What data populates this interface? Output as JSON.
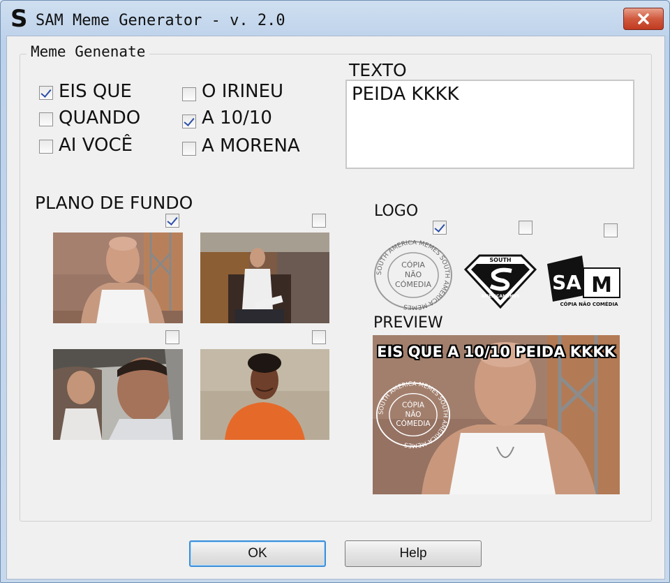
{
  "window": {
    "icon_letter": "S",
    "title": "SAM Meme Generator - v. 2.0"
  },
  "group": {
    "label": "Meme Genenate"
  },
  "intro_options": [
    {
      "label": "EIS QUE",
      "checked": true
    },
    {
      "label": "QUANDO",
      "checked": false
    },
    {
      "label": "AI VOCÊ",
      "checked": false
    },
    {
      "label": "O IRINEU",
      "checked": false
    },
    {
      "label": "A 10/10",
      "checked": true
    },
    {
      "label": "A MORENA",
      "checked": false
    }
  ],
  "texto": {
    "heading": "TEXTO",
    "value": "PEIDA KKKK"
  },
  "background": {
    "heading": "PLANO DE FUNDO",
    "options": [
      {
        "name": "bald-man-tank-top",
        "checked": true
      },
      {
        "name": "man-seated-chair",
        "checked": false
      },
      {
        "name": "man-in-car",
        "checked": false
      },
      {
        "name": "man-orange-shirt",
        "checked": false
      }
    ]
  },
  "logo": {
    "heading": "LOGO",
    "options": [
      {
        "name": "stamp-logo",
        "checked": true
      },
      {
        "name": "superman-logo",
        "checked": false
      },
      {
        "name": "sam-logo",
        "checked": false
      }
    ],
    "stamp_ring_text": "SOUTH AMERICA MEMES",
    "stamp_center_lines": [
      "CÓPIA",
      "NÃO",
      "CÓMEDIA"
    ],
    "super_top_text": "SOUTH",
    "super_bottom_text": "AMERICAMEMES",
    "sam_text": "SAM",
    "sam_subtitle": "CÓPIA NÃO COMÉDIA"
  },
  "preview": {
    "heading": "PREVIEW",
    "caption": "EIS QUE A 10/10 PEIDA KKKK"
  },
  "buttons": {
    "ok": "OK",
    "help": "Help"
  }
}
